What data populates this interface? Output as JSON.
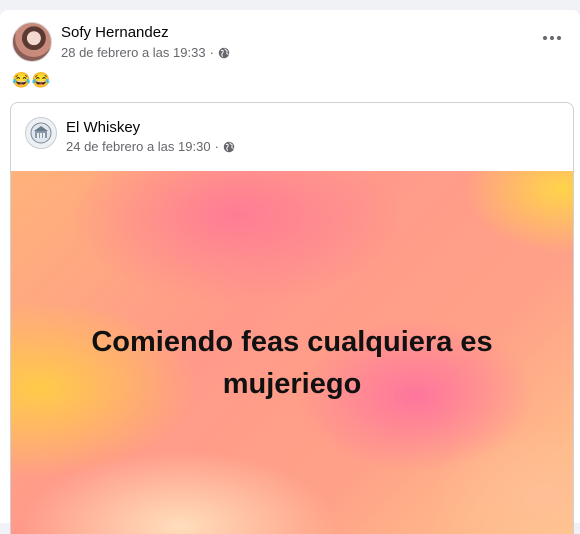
{
  "post": {
    "author": "Sofy Hernandez",
    "date": "28 de febrero a las 19:33",
    "separator": "·",
    "privacy_icon": "globe-icon",
    "more_icon": "more-options-icon",
    "text": "😂😂"
  },
  "shared": {
    "author": "El Whiskey",
    "date": "24 de febrero a las 19:30",
    "separator": "·",
    "privacy_icon": "globe-icon",
    "background_text": "Comiendo feas cualquiera es mujeriego"
  },
  "colors": {
    "page_bg": "#f0f2f5",
    "primary_text": "#050505",
    "secondary_text": "#65676b"
  }
}
